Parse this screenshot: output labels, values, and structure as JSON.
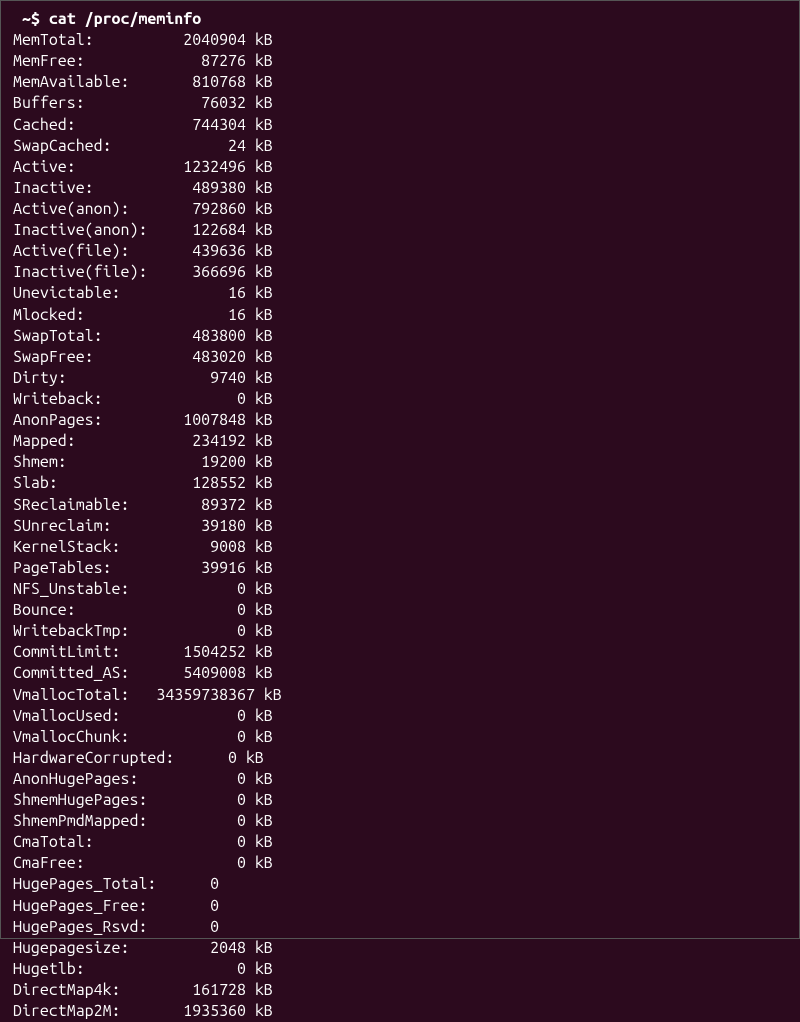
{
  "prompt": " ~$ cat /proc/meminfo",
  "entries": [
    {
      "label": "MemTotal:",
      "value": "2040904",
      "unit": "kB"
    },
    {
      "label": "MemFree:",
      "value": "87276",
      "unit": "kB"
    },
    {
      "label": "MemAvailable:",
      "value": "810768",
      "unit": "kB"
    },
    {
      "label": "Buffers:",
      "value": "76032",
      "unit": "kB"
    },
    {
      "label": "Cached:",
      "value": "744304",
      "unit": "kB"
    },
    {
      "label": "SwapCached:",
      "value": "24",
      "unit": "kB"
    },
    {
      "label": "Active:",
      "value": "1232496",
      "unit": "kB"
    },
    {
      "label": "Inactive:",
      "value": "489380",
      "unit": "kB"
    },
    {
      "label": "Active(anon):",
      "value": "792860",
      "unit": "kB"
    },
    {
      "label": "Inactive(anon):",
      "value": "122684",
      "unit": "kB"
    },
    {
      "label": "Active(file):",
      "value": "439636",
      "unit": "kB"
    },
    {
      "label": "Inactive(file):",
      "value": "366696",
      "unit": "kB"
    },
    {
      "label": "Unevictable:",
      "value": "16",
      "unit": "kB"
    },
    {
      "label": "Mlocked:",
      "value": "16",
      "unit": "kB"
    },
    {
      "label": "SwapTotal:",
      "value": "483800",
      "unit": "kB"
    },
    {
      "label": "SwapFree:",
      "value": "483020",
      "unit": "kB"
    },
    {
      "label": "Dirty:",
      "value": "9740",
      "unit": "kB"
    },
    {
      "label": "Writeback:",
      "value": "0",
      "unit": "kB"
    },
    {
      "label": "AnonPages:",
      "value": "1007848",
      "unit": "kB"
    },
    {
      "label": "Mapped:",
      "value": "234192",
      "unit": "kB"
    },
    {
      "label": "Shmem:",
      "value": "19200",
      "unit": "kB"
    },
    {
      "label": "Slab:",
      "value": "128552",
      "unit": "kB"
    },
    {
      "label": "SReclaimable:",
      "value": "89372",
      "unit": "kB"
    },
    {
      "label": "SUnreclaim:",
      "value": "39180",
      "unit": "kB"
    },
    {
      "label": "KernelStack:",
      "value": "9008",
      "unit": "kB"
    },
    {
      "label": "PageTables:",
      "value": "39916",
      "unit": "kB"
    },
    {
      "label": "NFS_Unstable:",
      "value": "0",
      "unit": "kB"
    },
    {
      "label": "Bounce:",
      "value": "0",
      "unit": "kB"
    },
    {
      "label": "WritebackTmp:",
      "value": "0",
      "unit": "kB"
    },
    {
      "label": "CommitLimit:",
      "value": "1504252",
      "unit": "kB"
    },
    {
      "label": "Committed_AS:",
      "value": "5409008",
      "unit": "kB"
    },
    {
      "label": "VmallocTotal:",
      "value": "34359738367",
      "unit": "kB"
    },
    {
      "label": "VmallocUsed:",
      "value": "0",
      "unit": "kB"
    },
    {
      "label": "VmallocChunk:",
      "value": "0",
      "unit": "kB"
    },
    {
      "label": "HardwareCorrupted:",
      "value": "0",
      "unit": "kB"
    },
    {
      "label": "AnonHugePages:",
      "value": "0",
      "unit": "kB"
    },
    {
      "label": "ShmemHugePages:",
      "value": "0",
      "unit": "kB"
    },
    {
      "label": "ShmemPmdMapped:",
      "value": "0",
      "unit": "kB"
    },
    {
      "label": "CmaTotal:",
      "value": "0",
      "unit": "kB"
    },
    {
      "label": "CmaFree:",
      "value": "0",
      "unit": "kB"
    },
    {
      "label": "HugePages_Total:",
      "value": "0",
      "unit": ""
    },
    {
      "label": "HugePages_Free:",
      "value": "0",
      "unit": ""
    },
    {
      "label": "HugePages_Rsvd:",
      "value": "0",
      "unit": ""
    },
    {
      "label": "Hugepagesize:",
      "value": "2048",
      "unit": "kB"
    },
    {
      "label": "Hugetlb:",
      "value": "0",
      "unit": "kB"
    },
    {
      "label": "DirectMap4k:",
      "value": "161728",
      "unit": "kB"
    },
    {
      "label": "DirectMap2M:",
      "value": "1935360",
      "unit": "kB"
    }
  ],
  "columns": {
    "label_width": 16,
    "value_width_default": 10,
    "value_width_hardware": 7,
    "value_width_hugepages": 7
  }
}
